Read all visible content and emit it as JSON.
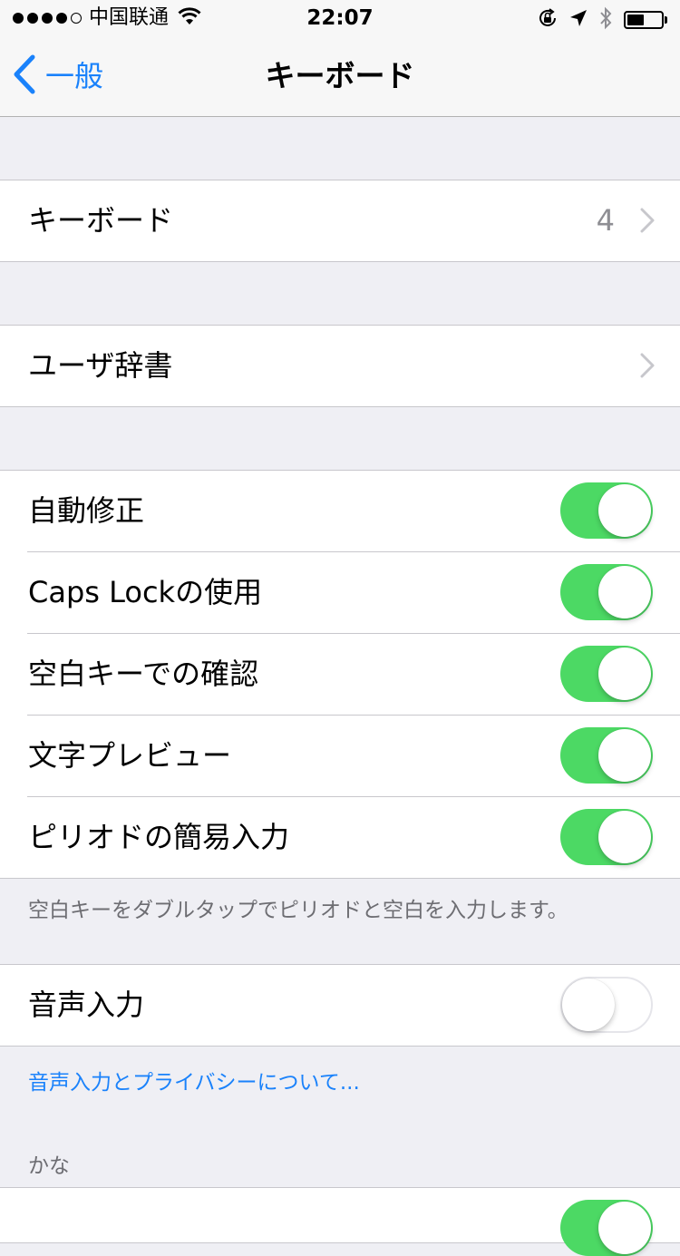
{
  "status_bar": {
    "carrier": "中国联通",
    "time": "22:07",
    "signal_dots_filled": 4,
    "signal_dots_total": 5,
    "battery_level": 0.5,
    "icons": [
      "wifi-icon",
      "orientation-lock-icon",
      "location-icon",
      "bluetooth-icon",
      "battery-icon"
    ]
  },
  "nav": {
    "back_label": "一般",
    "title": "キーボード"
  },
  "keyboards_cell": {
    "label": "キーボード",
    "value": "4"
  },
  "user_dict_cell": {
    "label": "ユーザ辞書"
  },
  "toggles": [
    {
      "label": "自動修正",
      "on": true
    },
    {
      "label": "Caps Lockの使用",
      "on": true
    },
    {
      "label": "空白キーでの確認",
      "on": true
    },
    {
      "label": "文字プレビュー",
      "on": true
    },
    {
      "label": "ピリオドの簡易入力",
      "on": true
    }
  ],
  "period_footer": "空白キーをダブルタップでピリオドと空白を入力します。",
  "dictation": {
    "label": "音声入力",
    "on": false
  },
  "dictation_link": "音声入力とプライバシーについて...",
  "kana_header": "かな",
  "colors": {
    "accent": "#1a82fb",
    "toggle_on": "#4cd964",
    "background": "#efeff4"
  }
}
